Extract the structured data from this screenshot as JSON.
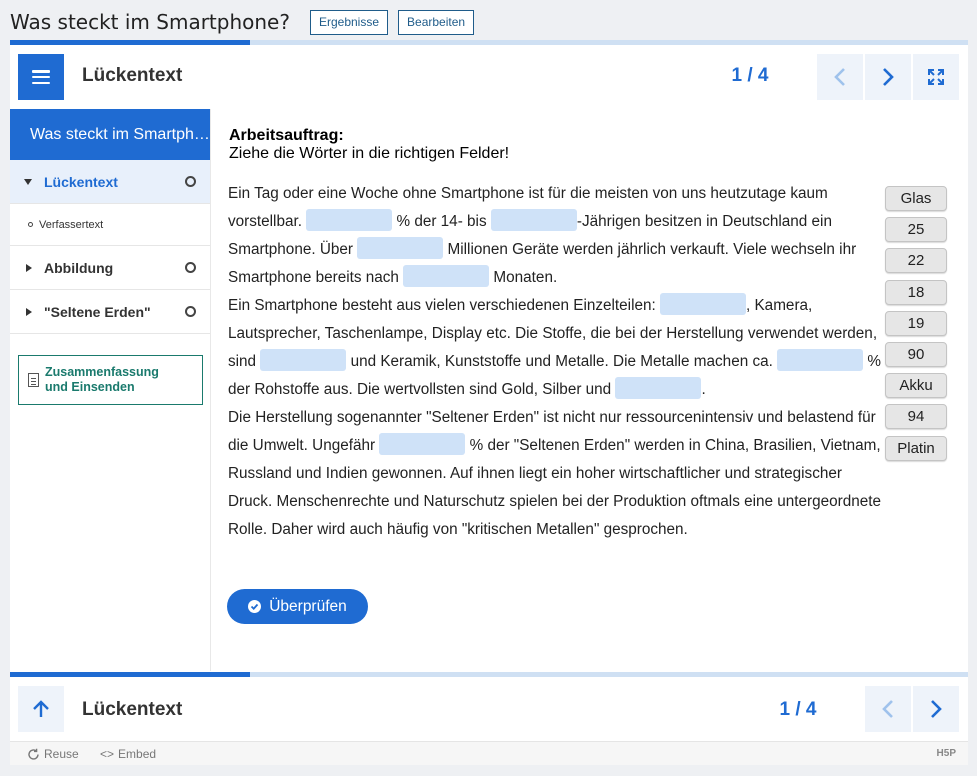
{
  "page": {
    "title": "Was steckt im Smartphone?",
    "buttons": {
      "results": "Ergebnisse",
      "edit": "Bearbeiten"
    }
  },
  "header": {
    "title": "Lückentext",
    "counter": "1 / 4"
  },
  "sidebar": {
    "heading": "Was steckt im Smartphone?",
    "items": [
      {
        "label": "Lückentext",
        "active": true
      },
      {
        "label": "Verfassertext",
        "sub": true
      },
      {
        "label": "Abbildung"
      },
      {
        "label": "\"Seltene Erden\""
      }
    ],
    "summary_line1": "Zusammenfassung",
    "summary_line2": "und Einsenden"
  },
  "task": {
    "heading": "Arbeitsauftrag:",
    "instruction": "Ziehe die Wörter in die richtigen Felder!"
  },
  "text": {
    "s1": "Ein Tag oder eine Woche ohne Smartphone ist für die meisten von uns heutzutage kaum vorstellbar.",
    "s2": "% der 14- bis",
    "s3": "-Jährigen besitzen in Deutschland ein Smartphone. Über",
    "s4": "Millionen Geräte werden jährlich verkauft. Viele wechseln ihr Smartphone bereits nach",
    "s5": "Monaten.",
    "s6": "Ein Smartphone besteht aus vielen verschiedenen Einzelteilen:",
    "s7": ", Kamera, Lautsprecher, Taschenlampe, Display etc. Die Stoffe, die bei der Herstellung verwendet werden, sind",
    "s8": "und Keramik, Kunststoffe und Metalle. Die Metalle machen ca.",
    "s9": "% der Rohstoffe aus. Die wertvollsten sind Gold, Silber und",
    "s10": ".",
    "s11": "Die Herstellung sogenannter \"Seltener Erden\" ist nicht nur ressourcenintensiv und belastend für die Umwelt. Ungefähr",
    "s12": "% der \"Seltenen Erden\" werden in China, Brasilien, Vietnam, Russland und Indien gewonnen. Auf ihnen liegt ein hoher wirtschaftlicher und strategischer Druck. Menschenrechte und Naturschutz spielen bei der Produktion oftmals eine untergeordnete Rolle. Daher wird auch häufig von \"kritischen Metallen\" gesprochen."
  },
  "words": [
    "Glas",
    "25",
    "22",
    "18",
    "19",
    "90",
    "Akku",
    "94",
    "Platin"
  ],
  "check_label": "Überprüfen",
  "footer": {
    "title": "Lückentext",
    "counter": "1 / 4"
  },
  "bottombar": {
    "reuse": "Reuse",
    "embed": "Embed",
    "brand": "H5P"
  },
  "colors": {
    "accent": "#1f6bd2",
    "gap": "#cfe2f8",
    "summary": "#1a7a6d"
  },
  "icons": [
    "menu-icon",
    "chevron-left-icon",
    "chevron-right-icon",
    "fullscreen-icon",
    "arrow-up-icon",
    "document-icon",
    "check-circle-icon",
    "reuse-icon",
    "embed-icon"
  ]
}
